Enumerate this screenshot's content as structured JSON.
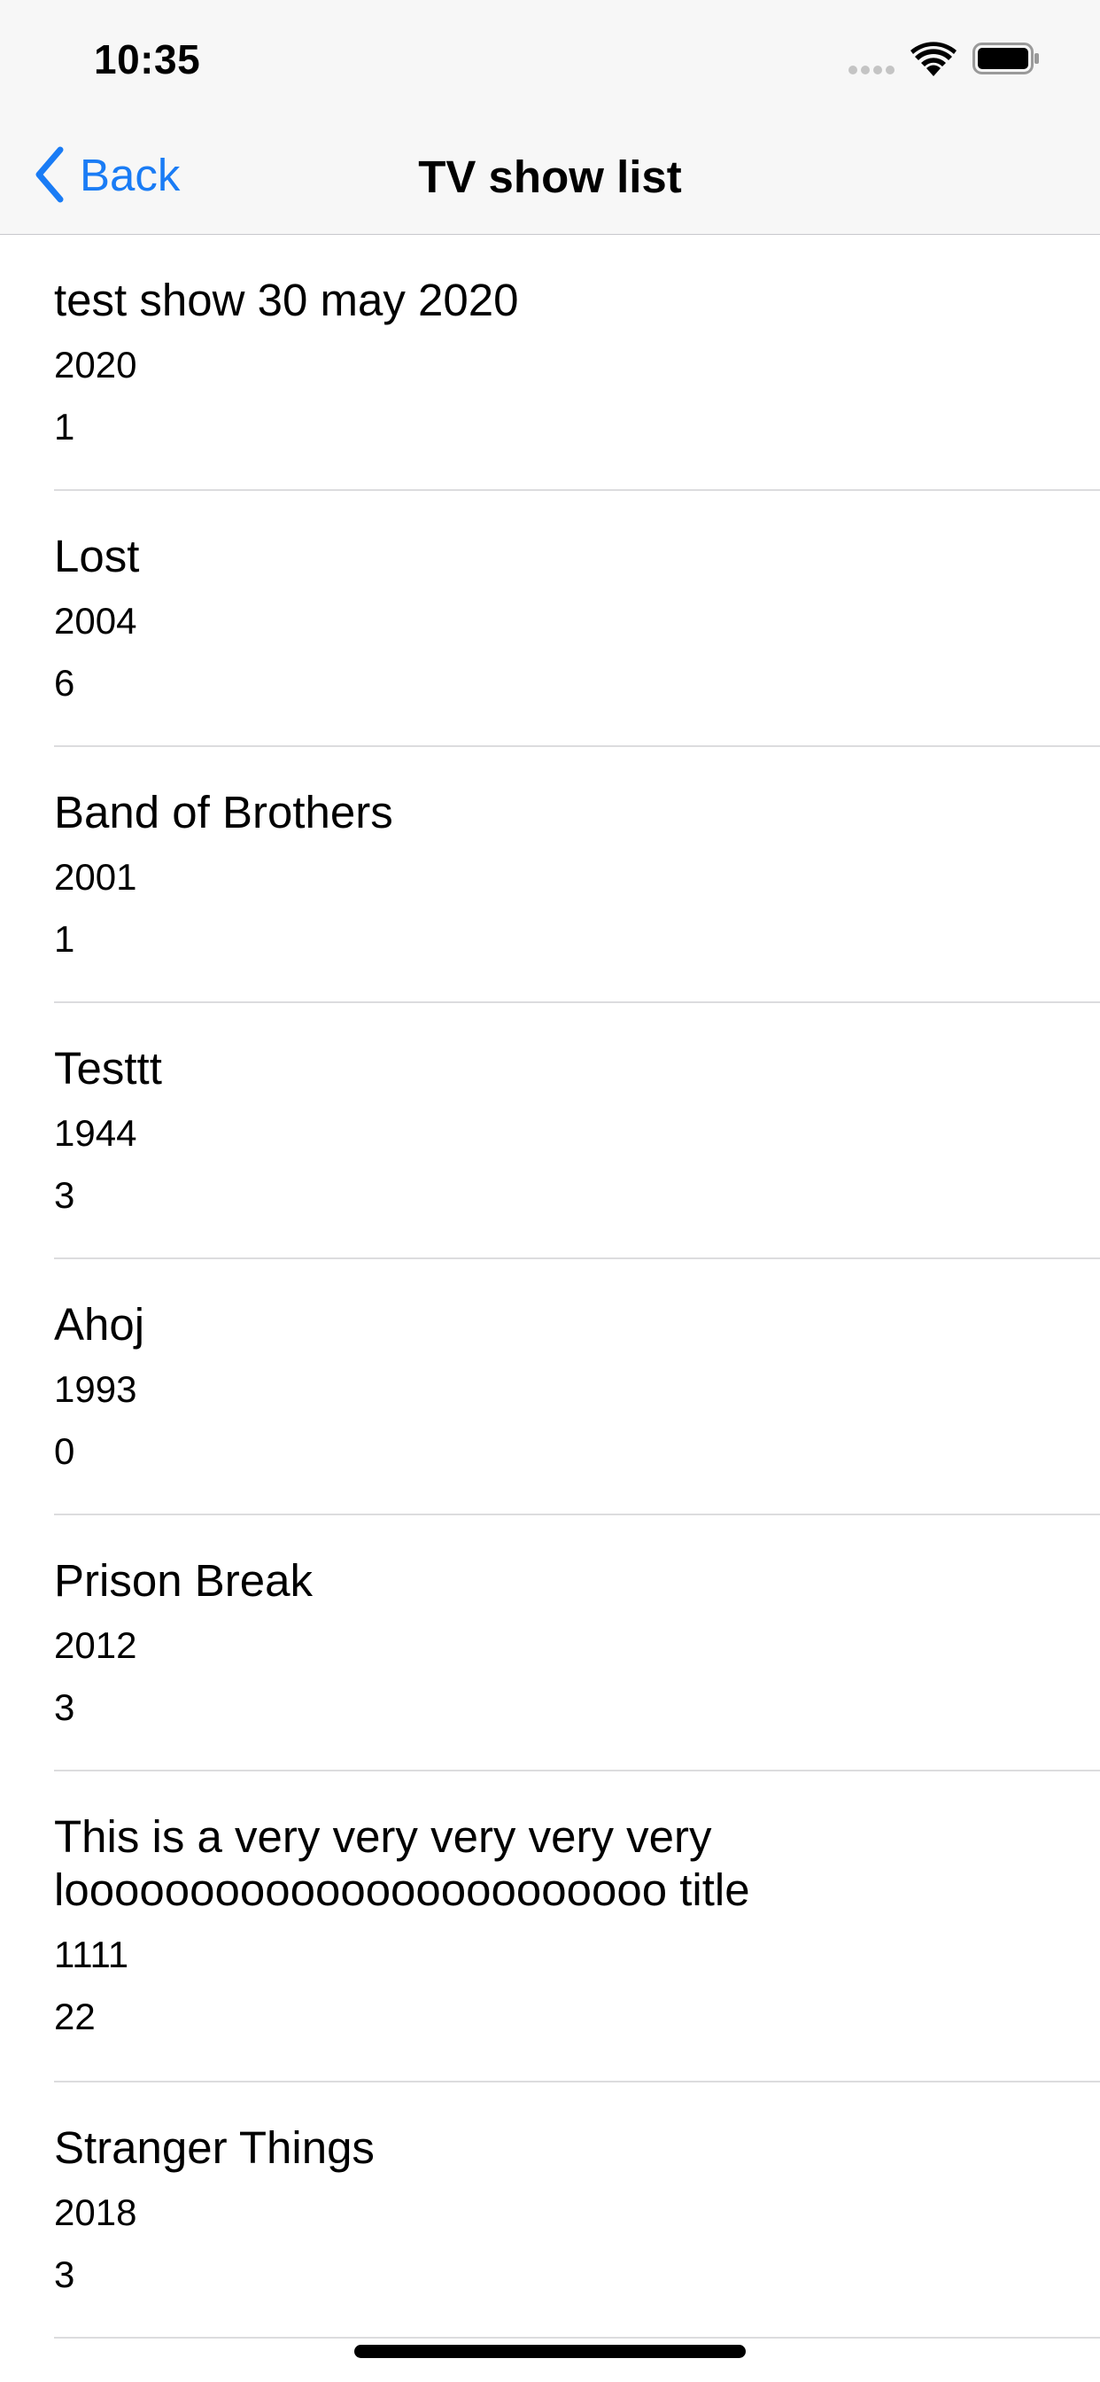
{
  "status_bar": {
    "time": "10:35",
    "icons": [
      "signal-dots-icon",
      "wifi-icon",
      "battery-icon"
    ]
  },
  "nav_bar": {
    "back_label": "Back",
    "title": "TV show list",
    "accent_color": "#1a7cf5"
  },
  "shows": [
    {
      "title": "test show 30 may 2020",
      "year": "2020",
      "seasons": "1"
    },
    {
      "title": "Lost",
      "year": "2004",
      "seasons": "6"
    },
    {
      "title": "Band of Brothers",
      "year": "2001",
      "seasons": "1"
    },
    {
      "title": "Testtt",
      "year": "1944",
      "seasons": "3"
    },
    {
      "title": "Ahoj",
      "year": "1993",
      "seasons": "0"
    },
    {
      "title": "Prison Break",
      "year": "2012",
      "seasons": "3"
    },
    {
      "title": "This is a very very very very very loooooooooooooooooooooooo title",
      "year": "1111",
      "seasons": "22"
    },
    {
      "title": "Stranger Things",
      "year": "2018",
      "seasons": "3"
    }
  ]
}
